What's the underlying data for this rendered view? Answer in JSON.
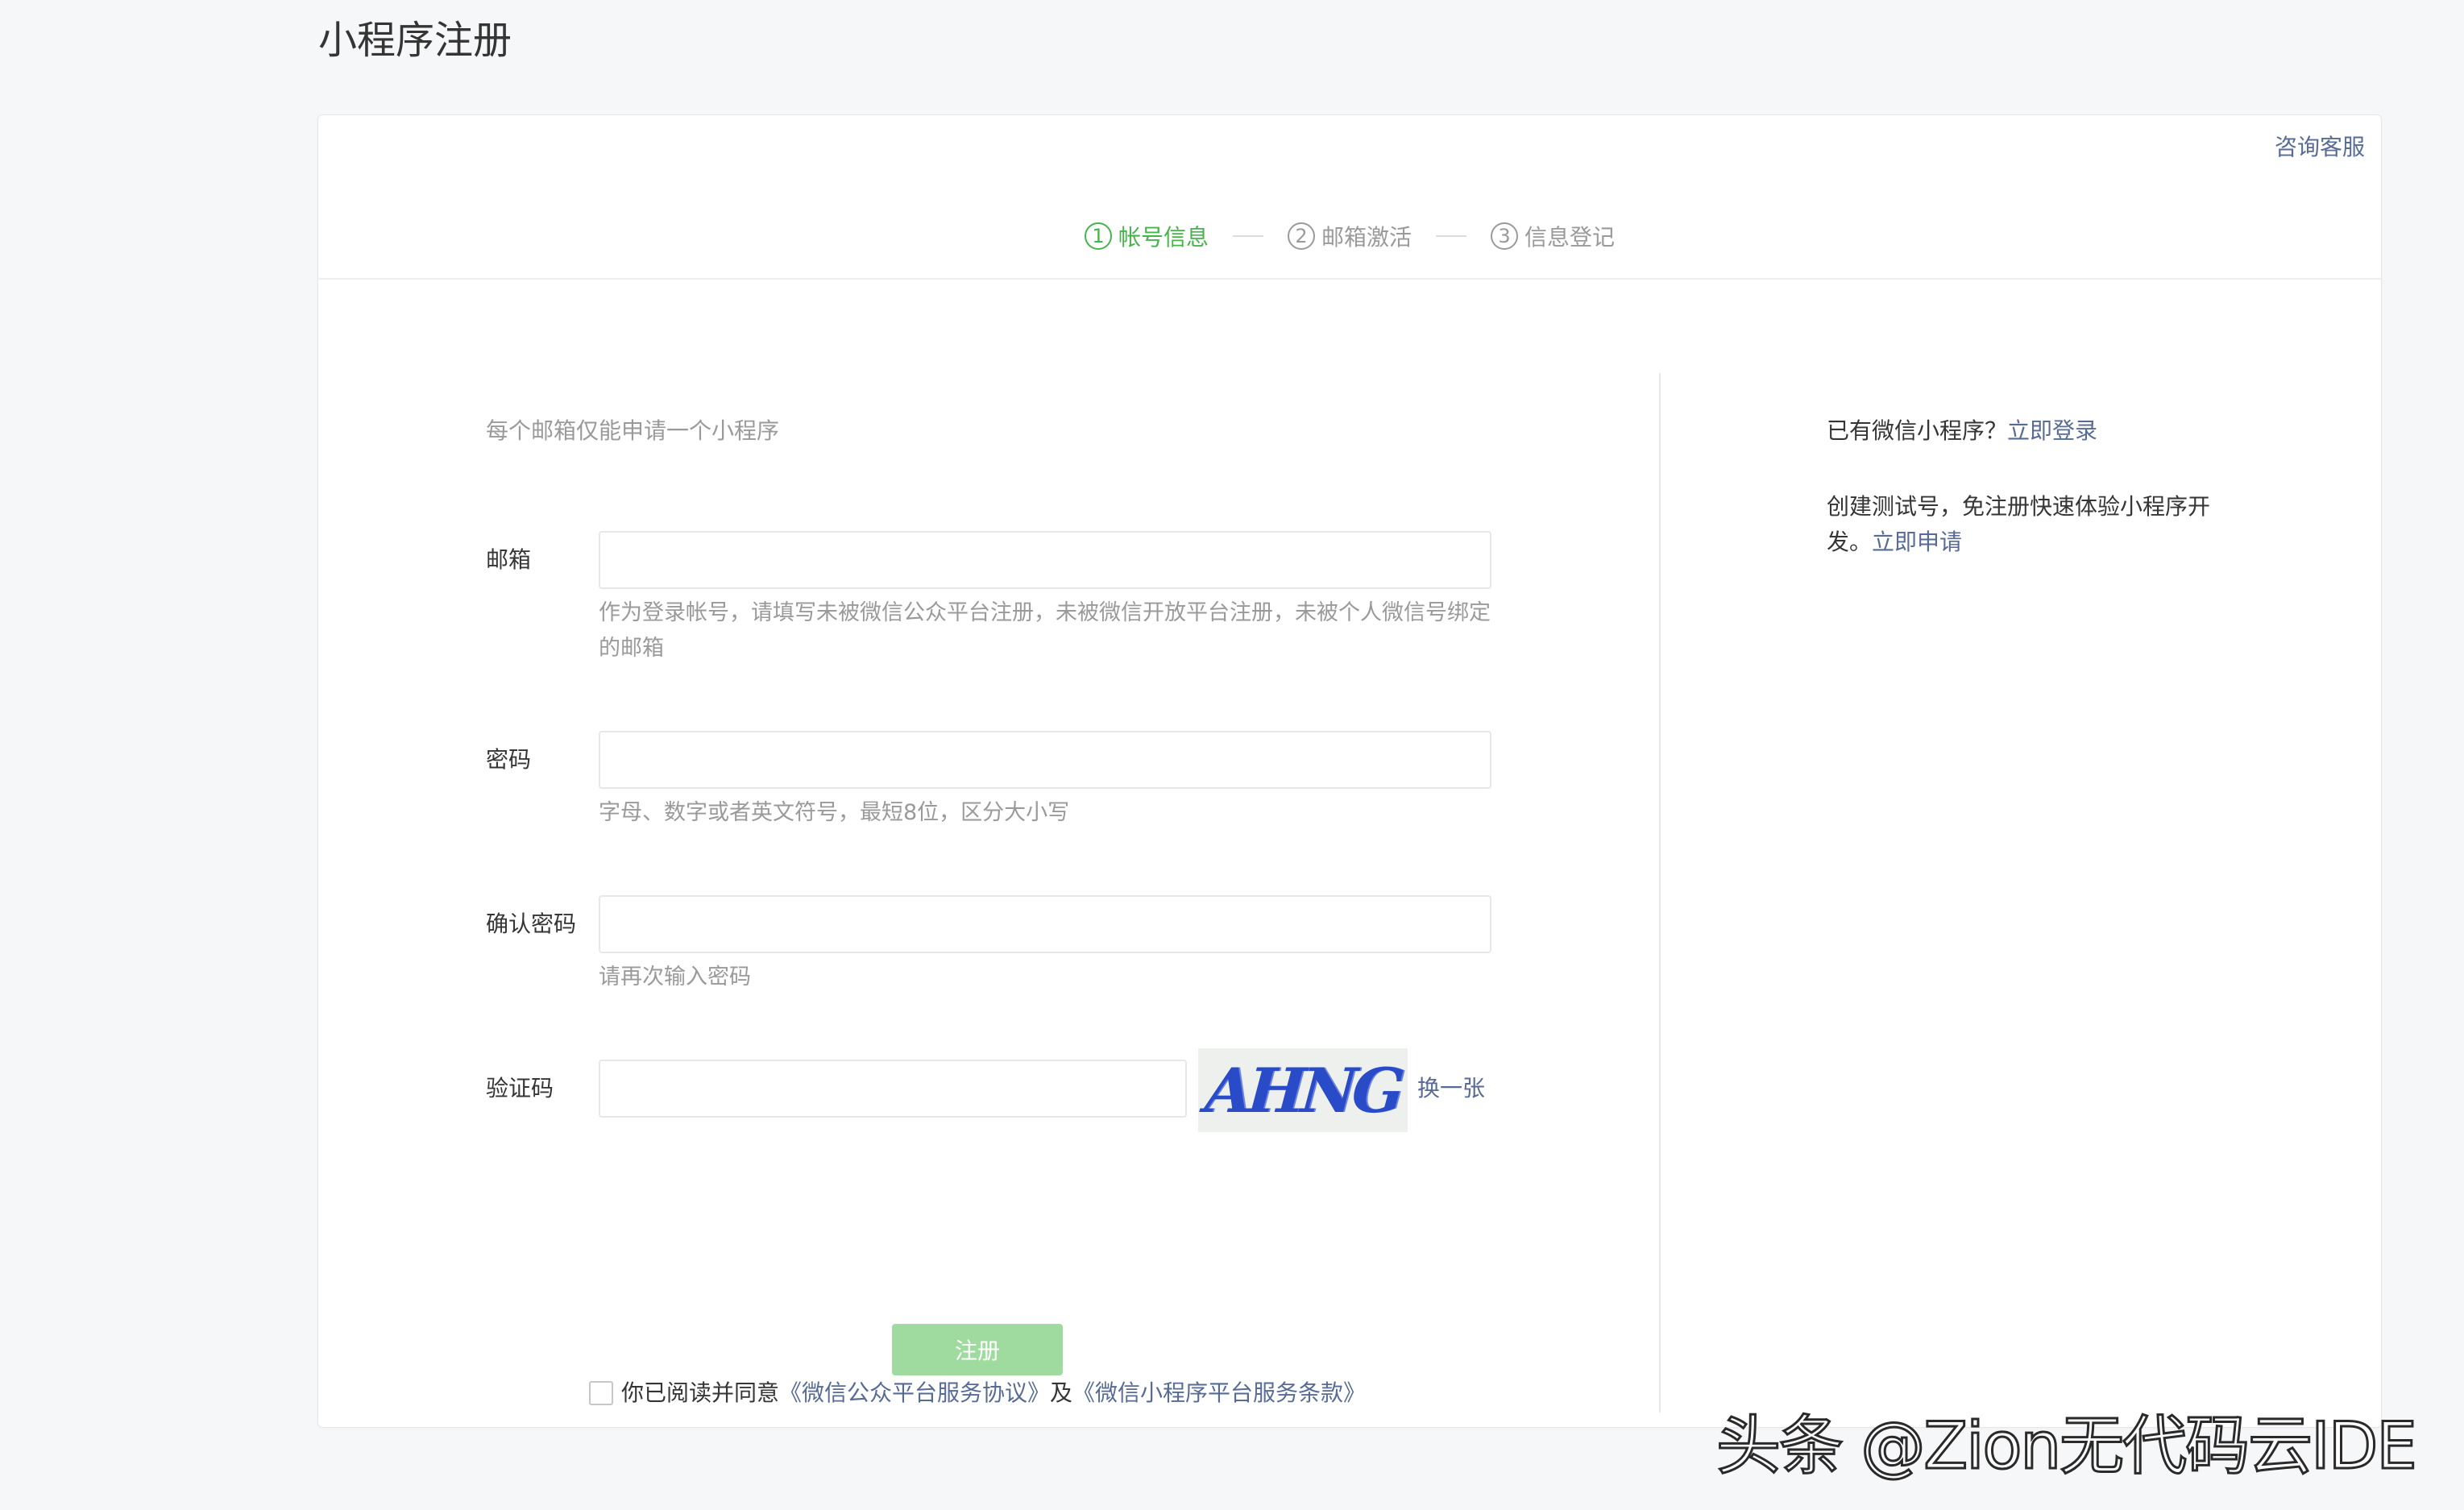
{
  "page": {
    "title": "小程序注册"
  },
  "header": {
    "consult_label": "咨询客服"
  },
  "steps": [
    {
      "num": "1",
      "label": "帐号信息",
      "active": true
    },
    {
      "num": "2",
      "label": "邮箱激活",
      "active": false
    },
    {
      "num": "3",
      "label": "信息登记",
      "active": false
    }
  ],
  "form": {
    "tips": "每个邮箱仅能申请一个小程序",
    "email": {
      "label": "邮箱",
      "value": "",
      "placeholder": "",
      "tip": "作为登录帐号，请填写未被微信公众平台注册，未被微信开放平台注册，未被个人微信号绑定的邮箱"
    },
    "password": {
      "label": "密码",
      "value": "",
      "placeholder": "",
      "tip": "字母、数字或者英文符号，最短8位，区分大小写"
    },
    "confirm": {
      "label": "确认密码",
      "value": "",
      "placeholder": "",
      "tip": "请再次输入密码"
    },
    "captcha": {
      "label": "验证码",
      "value": "",
      "image_text": "AHNG",
      "refresh_label": "换一张"
    },
    "agreement": {
      "checked": false,
      "prefix": "你已阅读并同意",
      "link1": "《微信公众平台服务协议》",
      "middle": "及",
      "link2": "《微信小程序平台服务条款》"
    },
    "submit_label": "注册"
  },
  "sidebar": {
    "login_prefix": "已有微信小程序？",
    "login_link": "立即登录",
    "test_text": "创建测试号，免注册快速体验小程序开发。",
    "test_link": "立即申请"
  },
  "watermark": {
    "text": "头条 @Zion无代码云IDE"
  },
  "colors": {
    "accent_green": "#44b549",
    "disabled_green": "#9fdb9f",
    "link_blue": "#576b95",
    "muted_gray": "#9a9a9a"
  }
}
